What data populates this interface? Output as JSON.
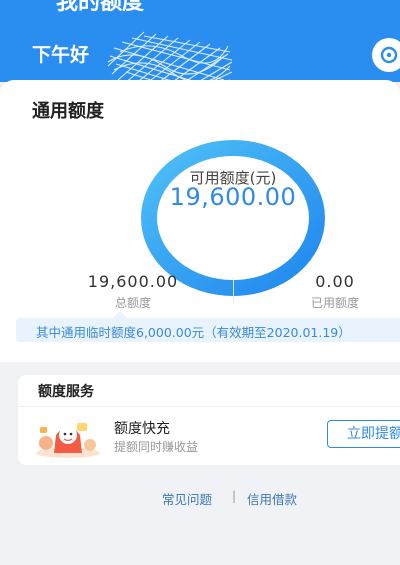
{
  "nav": {
    "title": "我的额度",
    "back_icon": "chevron-left-icon"
  },
  "header": {
    "greeting": "下午好",
    "right_icon": "service-icon",
    "colors": {
      "background": "#2a8ef0"
    }
  },
  "credit": {
    "section_title": "通用额度",
    "available_label": "可用额度(元)",
    "available_value": "19,600.00",
    "total_value": "19,600.00",
    "total_label": "总额度",
    "used_value": "0.00",
    "used_label": "已用额度",
    "notice": "其中通用临时额度6,000.00元（有效期至2020.01.19）",
    "colors": {
      "ring_start": "#4fc0f7",
      "ring_end": "#1f86ee",
      "value": "#2f8ae8"
    }
  },
  "services": {
    "section_title": "额度服务",
    "items": [
      {
        "name": "额度快充",
        "description": "提额同时赚收益",
        "button_label": "立即提额",
        "icon": "gift-bag-illustration"
      }
    ]
  },
  "footer": {
    "faq_label": "常见问题",
    "separator": "|",
    "loan_label": "信用借款"
  }
}
